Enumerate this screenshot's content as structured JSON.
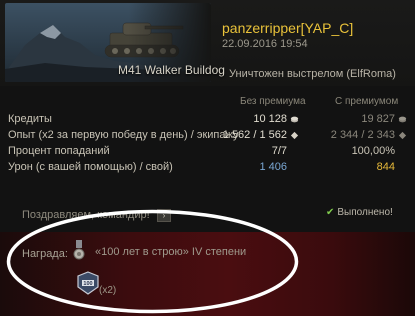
{
  "header": {
    "tank_name": "M41 Walker Buildog",
    "player": "panzerripper[YAP_C]",
    "datetime": "22.09.2016 19:54",
    "killed_by": "Уничтожен выстрелом (ElfRoma)"
  },
  "columns": {
    "without_premium": "Без премиума",
    "with_premium": "С премиумом"
  },
  "stats": [
    {
      "label": "Кредиты",
      "value1": "10 128",
      "value2": "19 827"
    },
    {
      "label": "Опыт  (x2 за первую победу в день) / экипажу",
      "value1": "1 562 / 1 562",
      "value2": "2 344 / 2 343"
    },
    {
      "label": "Процент попаданий",
      "value1": "7/7",
      "value2": "100,00%"
    },
    {
      "label": "Урон (с вашей помощью) / свой)",
      "value1": "1 406",
      "value2": "844"
    }
  ],
  "congrats": {
    "title": "Поздравляем, командир!",
    "arrow": "›",
    "status": "Выполнено!"
  },
  "reward": {
    "label": "Награда:",
    "text": "«100 лет в строю»  IV степени",
    "badge_text": "100",
    "multiplier": "(x2)"
  },
  "colors": {
    "player": "#e9c23a",
    "gold": "#e7b93a",
    "blue": "#7aa7d3",
    "reward_bg": "#4a0d10",
    "check": "#7fc94d"
  },
  "icons": [
    "credits-icon",
    "experience-icon",
    "checkmark-icon",
    "medal-icon",
    "badge-icon"
  ]
}
